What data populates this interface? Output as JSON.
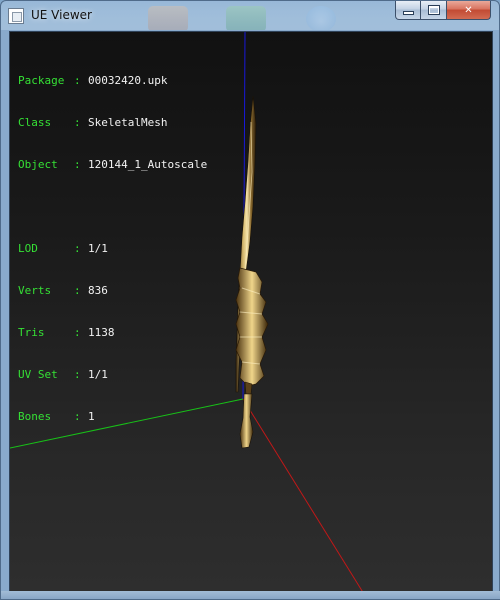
{
  "window": {
    "title": "UE Viewer",
    "controls": {
      "minimize_icon": "minimize-icon",
      "maximize_icon": "maximize-icon",
      "close_icon": "close-icon",
      "close_glyph": "✕"
    }
  },
  "info": {
    "package": {
      "label": "Package",
      "sep": ":",
      "value": "00032420.upk"
    },
    "class": {
      "label": "Class",
      "sep": ":",
      "value": "SkeletalMesh"
    },
    "object": {
      "label": "Object",
      "sep": ":",
      "value": "120144_1_Autoscale"
    },
    "lod": {
      "label": "LOD",
      "sep": ":",
      "value": "1/1"
    },
    "verts": {
      "label": "Verts",
      "sep": ":",
      "value": "836"
    },
    "tris": {
      "label": "Tris",
      "sep": ":",
      "value": "1138"
    },
    "uvset": {
      "label": "UV Set",
      "sep": ":",
      "value": "1/1"
    },
    "bones": {
      "label": "Bones",
      "sep": ":",
      "value": "1"
    }
  },
  "colors": {
    "label_green": "#35e035",
    "axis_x": "#c01818",
    "axis_y": "#18c018",
    "axis_z": "#1818d8",
    "background_top": "#111111",
    "background_bottom": "#2e2e2e"
  }
}
